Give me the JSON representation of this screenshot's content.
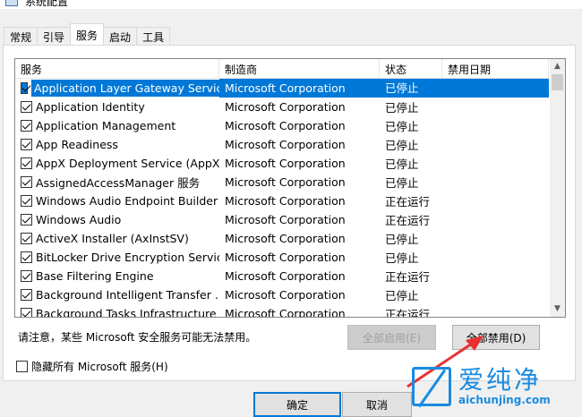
{
  "window": {
    "title": "系统配置"
  },
  "tabs": [
    {
      "label": "常规"
    },
    {
      "label": "引导"
    },
    {
      "label": "服务"
    },
    {
      "label": "启动"
    },
    {
      "label": "工具"
    }
  ],
  "columns": {
    "service": "服务",
    "vendor": "制造商",
    "status": "状态",
    "disabled_date": "禁用日期"
  },
  "rows": [
    {
      "service": "Application Layer Gateway Service",
      "vendor": "Microsoft Corporation",
      "status": "已停止",
      "checked": true,
      "selected": true
    },
    {
      "service": "Application Identity",
      "vendor": "Microsoft Corporation",
      "status": "已停止",
      "checked": true
    },
    {
      "service": "Application Management",
      "vendor": "Microsoft Corporation",
      "status": "已停止",
      "checked": true
    },
    {
      "service": "App Readiness",
      "vendor": "Microsoft Corporation",
      "status": "已停止",
      "checked": true
    },
    {
      "service": "AppX Deployment Service (AppX...",
      "vendor": "Microsoft Corporation",
      "status": "已停止",
      "checked": true
    },
    {
      "service": "AssignedAccessManager 服务",
      "vendor": "Microsoft Corporation",
      "status": "已停止",
      "checked": true
    },
    {
      "service": "Windows Audio Endpoint Builder",
      "vendor": "Microsoft Corporation",
      "status": "正在运行",
      "checked": true
    },
    {
      "service": "Windows Audio",
      "vendor": "Microsoft Corporation",
      "status": "正在运行",
      "checked": true
    },
    {
      "service": "ActiveX Installer (AxInstSV)",
      "vendor": "Microsoft Corporation",
      "status": "已停止",
      "checked": true
    },
    {
      "service": "BitLocker Drive Encryption Service",
      "vendor": "Microsoft Corporation",
      "status": "已停止",
      "checked": true
    },
    {
      "service": "Base Filtering Engine",
      "vendor": "Microsoft Corporation",
      "status": "正在运行",
      "checked": true
    },
    {
      "service": "Background Intelligent Transfer ...",
      "vendor": "Microsoft Corporation",
      "status": "已停止",
      "checked": true
    },
    {
      "service": "Background Tasks Infrastructure ...",
      "vendor": "Microsoft Corporation",
      "status": "正在运行",
      "checked": true
    }
  ],
  "note": "请注意，某些 Microsoft 安全服务可能无法禁用。",
  "buttons": {
    "enable_all": "全部启用(E)",
    "disable_all": "全部禁用(D)",
    "ok": "确定",
    "cancel": "取消"
  },
  "hide_ms": {
    "label": "隐藏所有 Microsoft 服务(H)",
    "checked": false
  },
  "watermark": {
    "name": "爱纯净",
    "url": "aichunjing.com"
  }
}
